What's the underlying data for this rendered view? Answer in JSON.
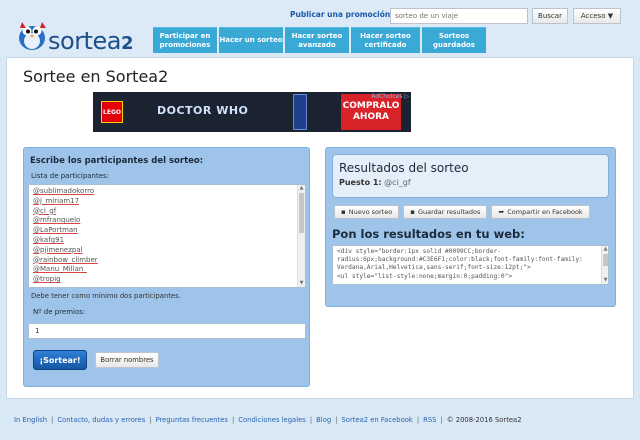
{
  "header": {
    "logo_text": "sortea",
    "logo_suffix": "2",
    "publish_link": "Publicar una promoción",
    "search_placeholder": "sorteo de un viaje",
    "search_button": "Buscar",
    "access_button": "Acceso ▼"
  },
  "nav": {
    "items": [
      {
        "label": "Participar en promociones"
      },
      {
        "label": "Hacer un sorteo"
      },
      {
        "label": "Hacer sorteo avanzado"
      },
      {
        "label": "Hacer sorteo certificado"
      },
      {
        "label": "Sorteos guardados"
      }
    ]
  },
  "main": {
    "title": "Sortee en Sortea2"
  },
  "banner": {
    "brand": "LEGO",
    "title": "DOCTOR WHO",
    "cta": "COMPRALO AHORA",
    "adchoices": "AdChoices ▷"
  },
  "left": {
    "heading": "Escribe los participantes del sorteo:",
    "list_label": "Lista de participantes:",
    "participants": [
      "@sublimadokorro",
      "@j_miriam17",
      "@ci_gf",
      "@mfranquelo",
      "@LaPortman",
      "@kafg91",
      "@pjimenezpal",
      "@rainbow_climber",
      "@Manu_Millan_",
      "@tropig"
    ],
    "hint": "Debe tener como mínimo dos participantes.",
    "prize_label": "Nº de premios:",
    "prize_value": "1",
    "draw_button": "¡Sortear!",
    "clear_button": "Borrar nombres"
  },
  "right": {
    "result_title": "Resultados del sorteo",
    "result_position": "Puesto 1:",
    "result_winner": "@ci_gf",
    "btn_new": "Nuevo sorteo",
    "btn_save": "Guardar resultados",
    "btn_share": "Compartir en Facebook",
    "embed_title": "Pon los resultados en tu web:",
    "embed_code": "<div style=\"border:1px solid #0099CC;border-radius:6px;background:#C3E6F1;color:black;font-family:font-family: Verdana,Arial,Helvetica,sans-serif;font-size:12pt;\">\n<ul style=\"list-style:none;margin:0;padding:0\">"
  },
  "footer": {
    "links": [
      "In English",
      "Contacto, dudas y errores",
      "Preguntas frecuentes",
      "Condiciones legales",
      "Blog",
      "Sortea2 en Facebook",
      "RSS"
    ],
    "copyright": "© 2008-2016 Sortea2"
  }
}
